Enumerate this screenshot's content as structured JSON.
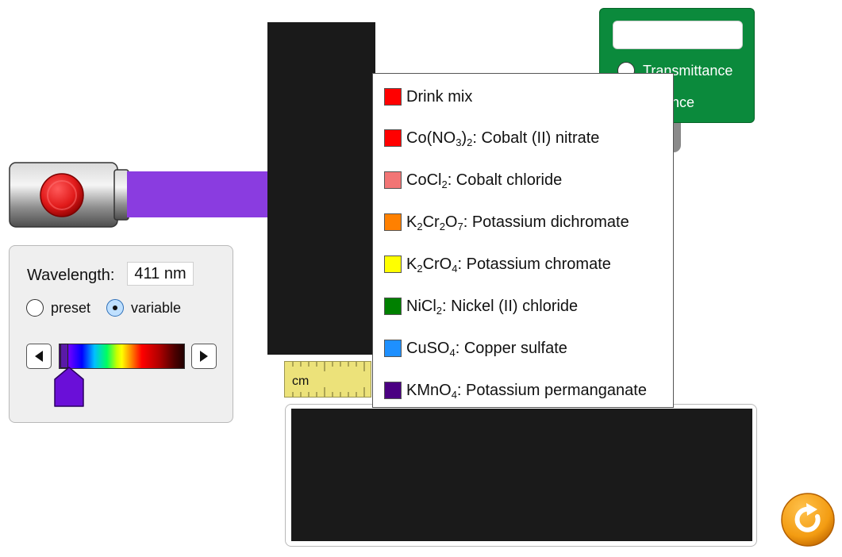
{
  "wavelength": {
    "label": "Wavelength:",
    "value": "411 nm",
    "mode_options": [
      "preset",
      "variable"
    ],
    "selected_mode": "variable",
    "spectrum_min_nm": 380,
    "spectrum_max_nm": 780,
    "left_icon": "left-arrow-icon",
    "right_icon": "right-arrow-icon"
  },
  "light_source": {
    "button_color": "#e11a1a",
    "beam_color": "#8a3ce0",
    "icon": "light-button-icon"
  },
  "ruler": {
    "unit": "cm"
  },
  "detector": {
    "color": "#0b8a3c",
    "display_value": "",
    "options": {
      "transmittance": "Transmittance",
      "absorbance": "orbance"
    }
  },
  "solutions": [
    {
      "swatch": "#ff0000",
      "formula": [],
      "name": "Drink mix"
    },
    {
      "swatch": "#ff0000",
      "formula": [
        [
          "Co(NO",
          ""
        ],
        [
          "3",
          "sub"
        ],
        [
          ")",
          ""
        ],
        [
          "2",
          "sub"
        ]
      ],
      "name": ": Cobalt (II) nitrate"
    },
    {
      "swatch": "#f27575",
      "formula": [
        [
          "CoCl",
          ""
        ],
        [
          "2",
          "sub"
        ]
      ],
      "name": ": Cobalt chloride"
    },
    {
      "swatch": "#ff8000",
      "formula": [
        [
          "K",
          ""
        ],
        [
          "2",
          "sub"
        ],
        [
          "Cr",
          ""
        ],
        [
          "2",
          "sub"
        ],
        [
          "O",
          ""
        ],
        [
          "7",
          "sub"
        ]
      ],
      "name": ": Potassium dichromate"
    },
    {
      "swatch": "#ffff00",
      "formula": [
        [
          "K",
          ""
        ],
        [
          "2",
          "sub"
        ],
        [
          "CrO",
          ""
        ],
        [
          "4",
          "sub"
        ]
      ],
      "name": ": Potassium chromate"
    },
    {
      "swatch": "#008000",
      "formula": [
        [
          "NiCl",
          ""
        ],
        [
          "2",
          "sub"
        ]
      ],
      "name": ": Nickel (II) chloride"
    },
    {
      "swatch": "#1e90ff",
      "formula": [
        [
          "CuSO",
          ""
        ],
        [
          "4",
          "sub"
        ]
      ],
      "name": ": Copper sulfate"
    },
    {
      "swatch": "#4b0082",
      "formula": [
        [
          "KMnO",
          ""
        ],
        [
          "4",
          "sub"
        ]
      ],
      "name": ": Potassium permanganate"
    }
  ],
  "reset": {
    "icon": "reset-icon",
    "color": "#f39c12"
  }
}
